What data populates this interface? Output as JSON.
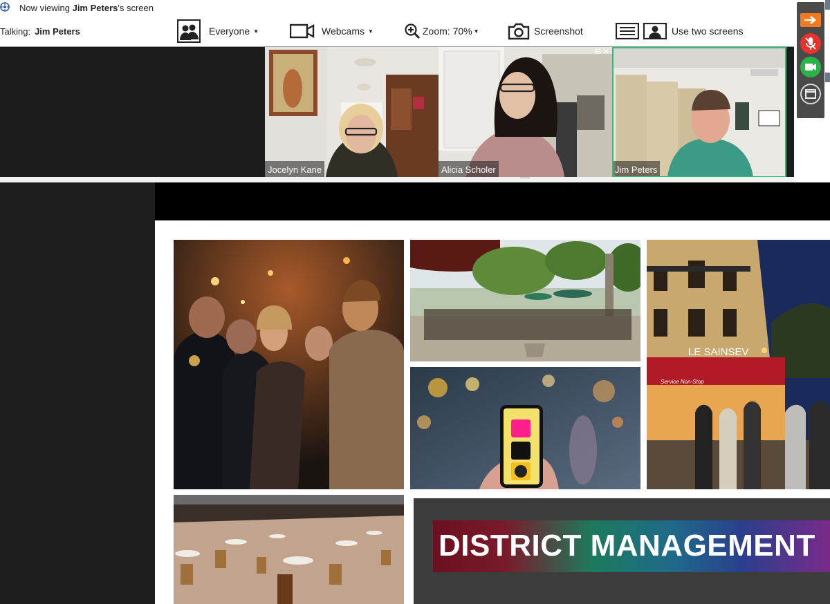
{
  "header": {
    "viewing_prefix": "Now viewing ",
    "viewing_name": "Jim Peters",
    "viewing_suffix": "'s screen",
    "talking_label": "Talking:",
    "talking_name": "Jim Peters"
  },
  "toolbar": {
    "everyone_label": "Everyone",
    "webcams_label": "Webcams",
    "zoom_label": "Zoom: 70%",
    "screenshot_label": "Screenshot",
    "two_screens_label": "Use two screens"
  },
  "participants": [
    {
      "name": "Jocelyn Kane"
    },
    {
      "name": "Alicia Scholer"
    },
    {
      "name": "Jim Peters"
    }
  ],
  "slide": {
    "title": "DISTRICT MANAGEMENT",
    "paris_sign": "LE SAINSEV",
    "cafe_sign": "Service Non-Stop"
  },
  "colors": {
    "active_speaker": "#2dbf75",
    "mic_button": "#e8322e",
    "camera_button": "#29b34a",
    "share_button": "#f47a20"
  }
}
